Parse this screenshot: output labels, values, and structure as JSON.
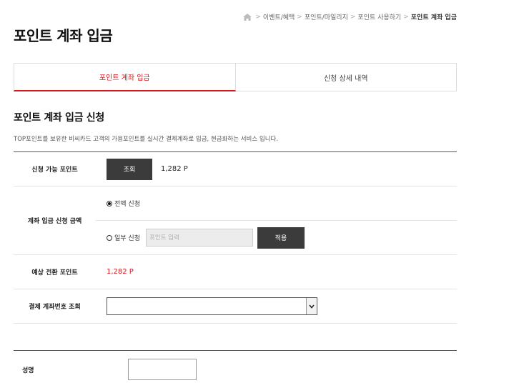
{
  "breadcrumb": {
    "items": [
      "이벤트/혜택",
      "포인트/마일리지",
      "포인트 사용하기"
    ],
    "current": "포인트 계좌 입금"
  },
  "page_title": "포인트 계좌 입금",
  "tabs": [
    {
      "label": "포인트 계좌 입금",
      "active": true
    },
    {
      "label": "신청 상세 내역",
      "active": false
    }
  ],
  "section": {
    "title": "포인트 계좌 입금 신청",
    "description": "TOP포인트를 보유한 비씨카드 고객의 가용포인트를 실시간 결제계좌로 입금, 현금화하는 서비스 입니다."
  },
  "form": {
    "available_points": {
      "label": "신청 가능 포인트",
      "button": "조회",
      "value": "1,282 P"
    },
    "amount": {
      "label": "계좌 입금 신청 금액",
      "full_option": "전액 신청",
      "partial_option": "일부 신청",
      "partial_placeholder": "포인트 입력",
      "apply_button": "적용",
      "selected": "full"
    },
    "expected": {
      "label": "예상 전환 포인트",
      "value": "1,282 P"
    },
    "account": {
      "label": "결제 계좌번호 조회",
      "value": ""
    },
    "name": {
      "label": "성명",
      "value": ""
    }
  },
  "colors": {
    "accent": "#d71920",
    "dark_button": "#3b3b3b"
  }
}
